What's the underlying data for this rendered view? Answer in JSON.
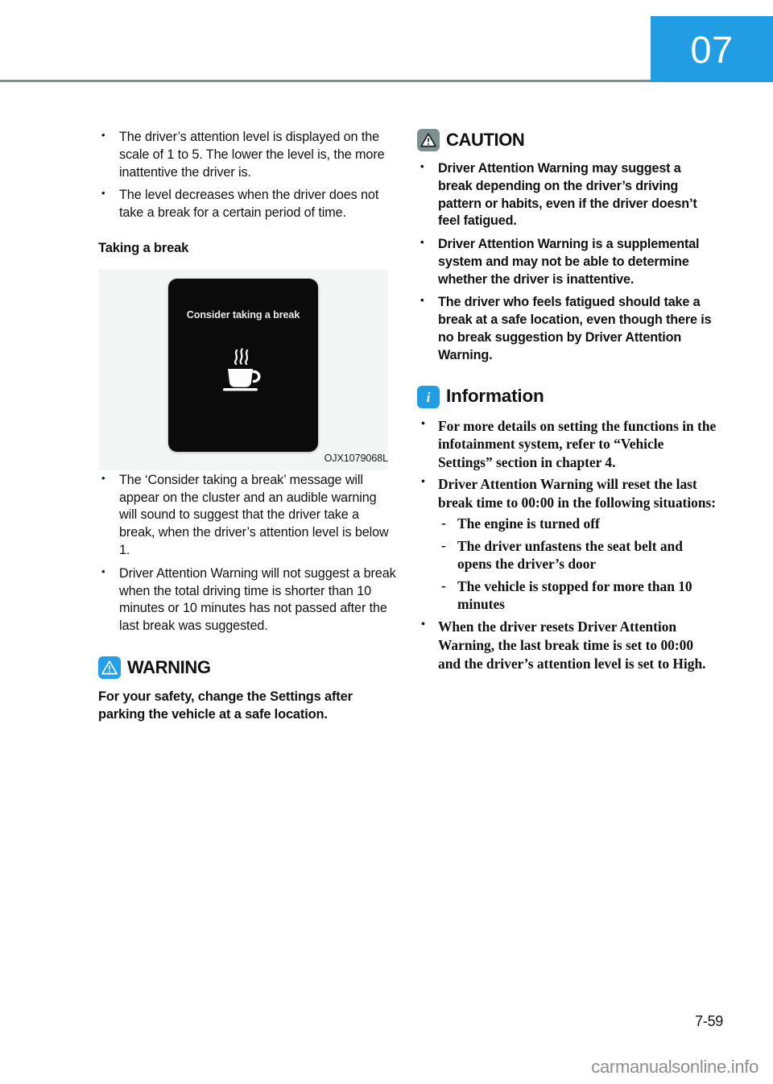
{
  "header": {
    "chapter_number": "07",
    "accent_color": "#219de3",
    "rule_color": "#7d908f"
  },
  "left_column": {
    "intro_bullets": [
      "The driver’s attention level is displayed on the scale of 1 to 5. The lower the level is, the more inattentive the driver is.",
      "The level decreases when the driver does not take a break for a certain period of time."
    ],
    "section_heading": "Taking a break",
    "figure": {
      "cluster_message": "Consider taking a break",
      "icon_name": "coffee-cup-icon",
      "caption": "OJX1079068L"
    },
    "figure_bullets": [
      "The ‘Consider taking a break’ message will appear on the cluster and an audible warning will sound to suggest that the driver take a break, when the driver’s attention level is below 1.",
      "Driver Attention Warning will not suggest a break when the total driving time is shorter than 10 minutes or 10 minutes has not passed after the last break was suggested."
    ],
    "warning": {
      "title": "WARNING",
      "icon_name": "warning-triangle-icon",
      "icon_color": "#23a0e8",
      "body": "For your safety, change the Settings after parking the vehicle at a safe location."
    }
  },
  "right_column": {
    "caution": {
      "title": "CAUTION",
      "icon_name": "caution-triangle-icon",
      "icon_color": "#7d908f",
      "bullets": [
        "Driver Attention Warning may suggest a break depending on the driver’s driving pattern or habits, even if the driver doesn’t feel fatigued.",
        "Driver Attention Warning is a supplemental system and may not be able to determine whether the driver is inattentive.",
        "The driver who feels fatigued should take a break at a safe location, even though there is no break suggestion by Driver Attention Warning."
      ]
    },
    "information": {
      "title": "Information",
      "icon_name": "information-i-icon",
      "icon_color": "#219de3",
      "bullet_1": "For more details on setting the functions in the infotainment system, refer to “Vehicle Settings” section in chapter 4.",
      "bullet_2": "Driver Attention Warning will reset the last break time to 00:00 in the following situations:",
      "sub_bullets": [
        "The engine is turned off",
        "The driver unfastens the seat belt and opens the driver’s door",
        "The vehicle is stopped for more than 10 minutes"
      ],
      "bullet_3": "When the driver resets Driver Attention Warning, the last break time is set to 00:00 and the driver’s attention level is set to High."
    }
  },
  "footer": {
    "page_number": "7-59",
    "watermark": "carmanualsonline.info"
  }
}
